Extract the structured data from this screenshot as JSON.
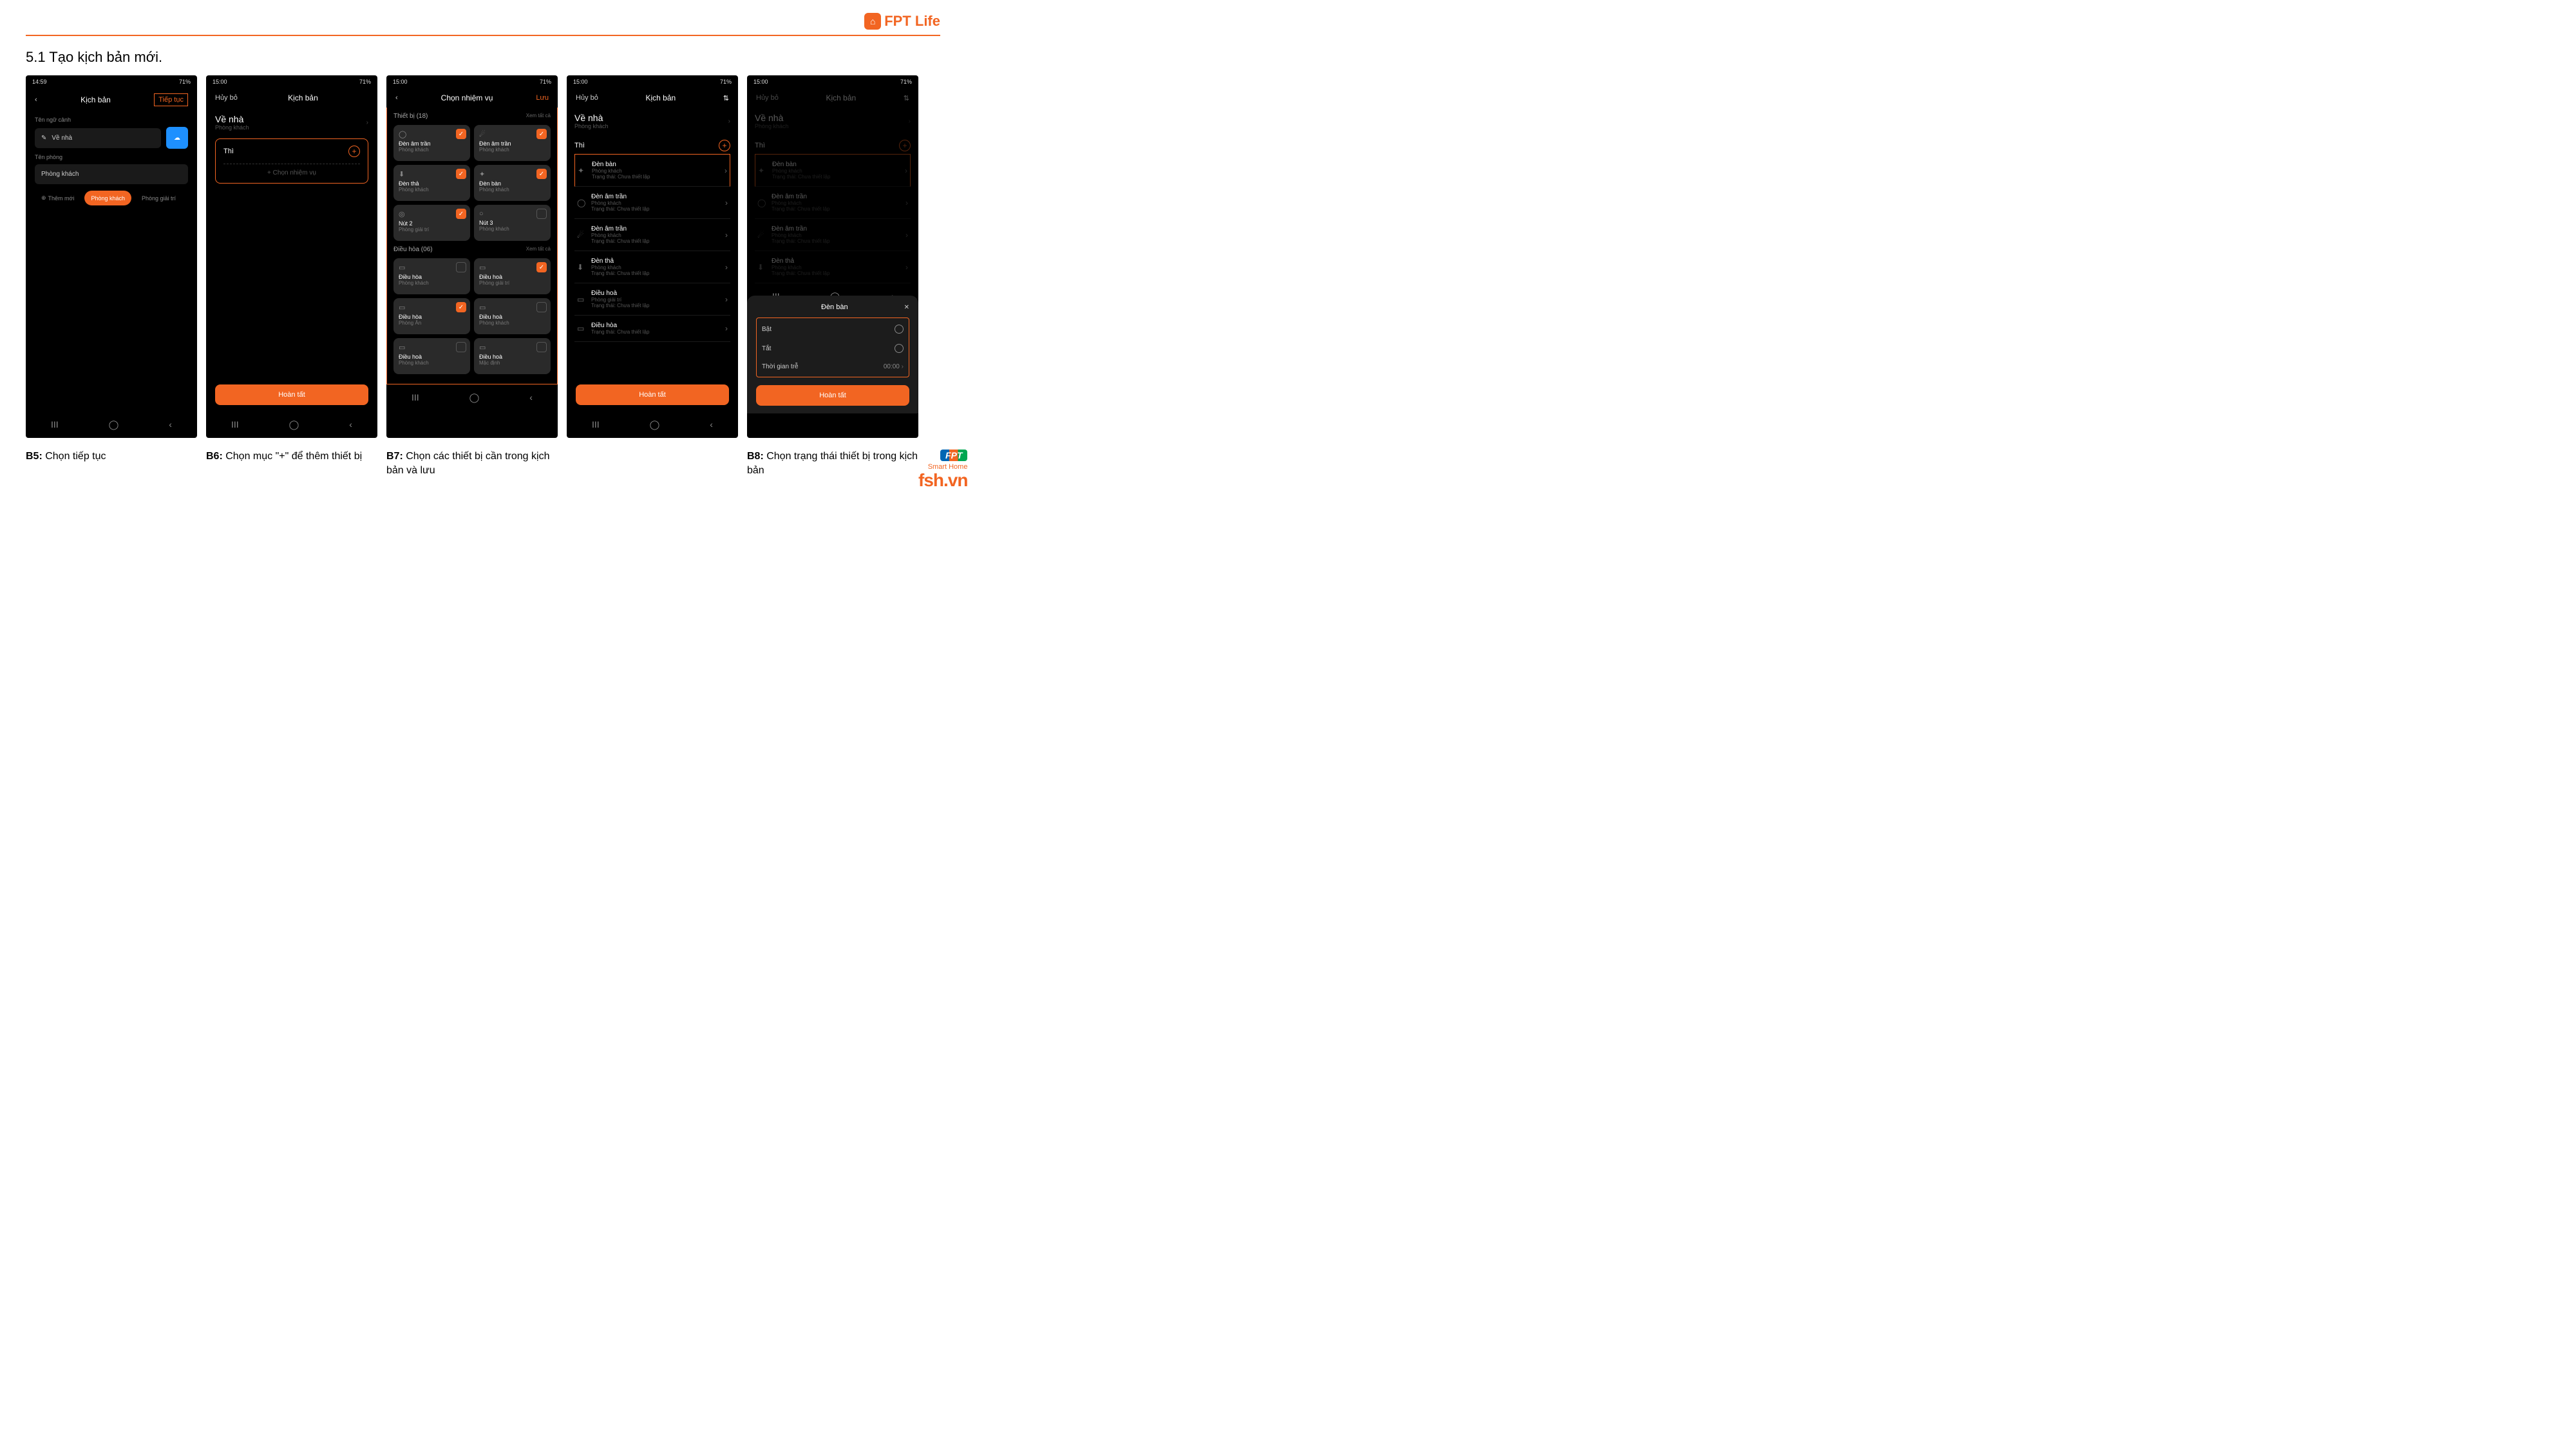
{
  "brand": {
    "name": "FPT Life"
  },
  "section_title": "5.1 Tạo kịch bản mới.",
  "status": {
    "time1": "14:59",
    "time2": "15:00",
    "right": "71%"
  },
  "s5": {
    "back": "‹",
    "title": "Kịch bản",
    "cont": "Tiếp tục",
    "lbl1": "Tên ngữ cảnh",
    "val1": "Về nhà",
    "lbl2": "Tên phòng",
    "val2": "Phòng khách",
    "chip_new": "Thêm mới",
    "chip1": "Phòng khách",
    "chip2": "Phòng giải trí"
  },
  "s6": {
    "cancel": "Hủy bỏ",
    "title": "Kịch bản",
    "scene": "Về nhà",
    "room": "Phòng khách",
    "thi": "Thì",
    "add_task": "+  Chọn nhiệm vụ",
    "done": "Hoàn tất"
  },
  "s7": {
    "back": "‹",
    "title": "Chọn nhiệm vụ",
    "save": "Lưu",
    "g1": "Thiết bị (18)",
    "g2": "Điều hòa (06)",
    "all": "Xem tất cả",
    "devs1": [
      {
        "n": "Đèn âm trần",
        "r": "Phòng khách",
        "c": true,
        "i": "◯"
      },
      {
        "n": "Đèn âm trần",
        "r": "Phòng khách",
        "c": true,
        "i": "☄"
      },
      {
        "n": "Đèn thả",
        "r": "Phòng khách",
        "c": true,
        "i": "⬇"
      },
      {
        "n": "Đèn bàn",
        "r": "Phòng khách",
        "c": true,
        "i": "✦"
      },
      {
        "n": "Nút 2",
        "r": "Phòng giải trí",
        "c": true,
        "i": "◎"
      },
      {
        "n": "Nút 3",
        "r": "Phòng khách",
        "c": false,
        "i": "○"
      }
    ],
    "devs2": [
      {
        "n": "Điều hòa",
        "r": "Phòng khách",
        "c": false,
        "i": "▭"
      },
      {
        "n": "Điều hoà",
        "r": "Phòng giải trí",
        "c": true,
        "i": "▭"
      },
      {
        "n": "Điều hòa",
        "r": "Phòng Ăn",
        "c": true,
        "i": "▭"
      },
      {
        "n": "Điều hoà",
        "r": "Phòng khách",
        "c": false,
        "i": "▭"
      },
      {
        "n": "Điều hoà",
        "r": "Phòng khách",
        "c": false,
        "i": "▭"
      },
      {
        "n": "Điều hoà",
        "r": "Mặc định",
        "c": false,
        "i": "▭"
      }
    ]
  },
  "s8": {
    "cancel": "Hủy bỏ",
    "title": "Kịch bản",
    "scene": "Về nhà",
    "room": "Phòng khách",
    "thi": "Thì",
    "status": "Trạng thái: Chưa thiết lập",
    "list": [
      {
        "n": "Đèn bàn",
        "r": "Phòng khách",
        "i": "✦",
        "hl": true
      },
      {
        "n": "Đèn âm trần",
        "r": "Phòng khách",
        "i": "◯"
      },
      {
        "n": "Đèn âm trần",
        "r": "Phòng khách",
        "i": "☄"
      },
      {
        "n": "Đèn thả",
        "r": "Phòng khách",
        "i": "⬇"
      },
      {
        "n": "Điều hoà",
        "r": "Phòng giải trí",
        "i": "▭"
      },
      {
        "n": "Điều hòa",
        "r": "",
        "i": "▭"
      }
    ],
    "done": "Hoàn tất"
  },
  "s9": {
    "title": "Kịch bản",
    "cancel": "Hủy bỏ",
    "sheet_title": "Đèn bàn",
    "on": "Bật",
    "off": "Tắt",
    "delay": "Thời gian trễ",
    "delay_v": "00:00",
    "done": "Hoàn tất"
  },
  "captions": {
    "b5": "B5:",
    "t5": " Chọn tiếp tục",
    "b6": "B6:",
    "t6": " Chọn mục \"+\" để thêm thiết bị",
    "b7": "B7:",
    "t7": " Chọn các thiết bị cần trong kịch bản và lưu",
    "b8": "B8:",
    "t8": " Chọn trạng thái thiết bị trong kịch bản"
  },
  "footer": {
    "sh": "Smart Home",
    "dom": "fsh.vn",
    "badge": "FPT"
  }
}
